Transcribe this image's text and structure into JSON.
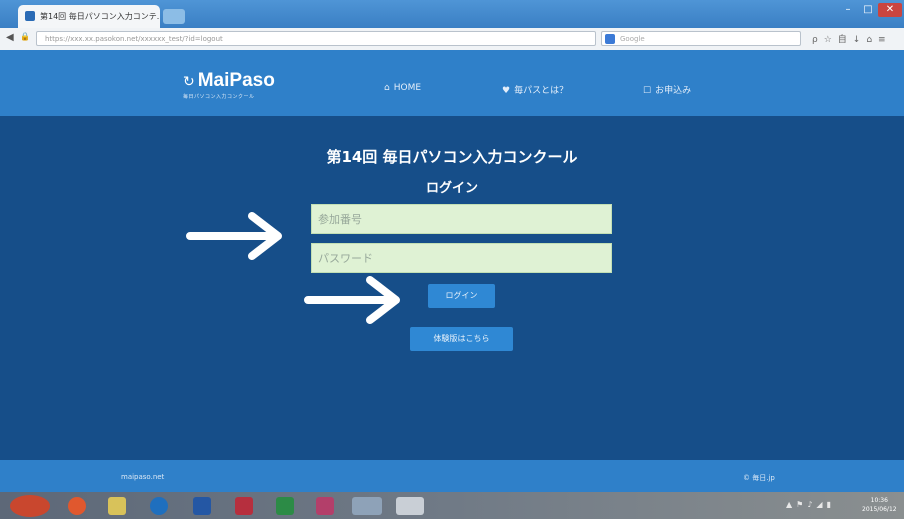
{
  "browser": {
    "tab_title": "第14回 毎日パソコン入力コンテ...",
    "url": "https://xxx.xx.pasokon.net/xxxxxx_test/?id=logout",
    "search_placeholder": "Google",
    "window_controls": {
      "minimize": "–",
      "maximize": "□",
      "close": "✕"
    },
    "nav": {
      "back": "◀",
      "lock": "🔒"
    },
    "toolbar_icons": "ρ☆自↓⌂≡"
  },
  "header": {
    "logo_mark": "↻",
    "logo_name": "MaiPaso",
    "logo_tagline": "毎日パソコン入力コンクール",
    "nav": [
      {
        "icon": "⌂",
        "label": "HOME"
      },
      {
        "icon": "♥",
        "label": "毎パスとは？"
      },
      {
        "icon": "☐",
        "label": "お申込み"
      }
    ]
  },
  "main": {
    "title": "第14回 毎日パソコン入力コンクール",
    "subtitle": "ログイン",
    "username_placeholder": "参加番号",
    "password_placeholder": "パスワード",
    "login_label": "ログイン",
    "trial_label": "体験版はこちら"
  },
  "footer": {
    "site": "maipaso.net",
    "copyright": "© 毎日.jp"
  },
  "taskbar": {
    "clock_time": "10:36",
    "clock_date": "2015/06/12"
  },
  "colors": {
    "header": "#2f80c9",
    "main_bg": "#164e89",
    "input_bg": "#dff2d4",
    "button": "#2f88d4"
  }
}
